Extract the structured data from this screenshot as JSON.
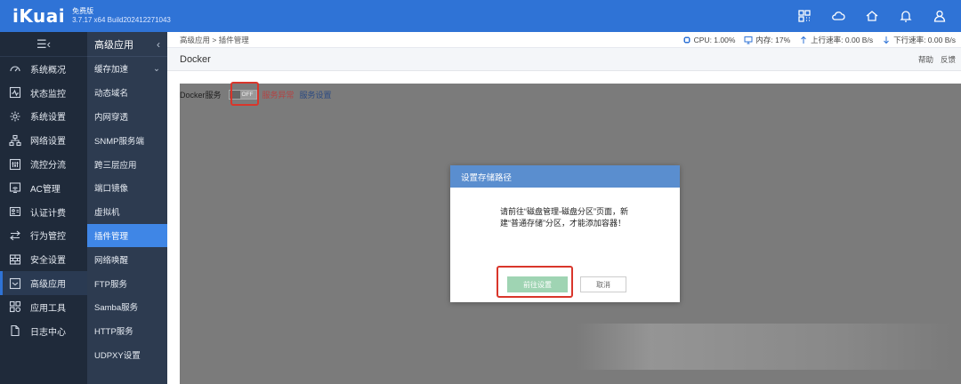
{
  "brand": {
    "logo": "iKuai",
    "edition": "免费版",
    "build": "3.7.17 x64 Build202412271043"
  },
  "topbar_icons": [
    "grid-apps-icon",
    "cloud-icon",
    "home-icon",
    "bell-icon",
    "user-icon"
  ],
  "nav": {
    "toggle": "☰‹",
    "items": [
      {
        "label": "系统概况",
        "icon": "speedometer-icon"
      },
      {
        "label": "状态监控",
        "icon": "pulse-icon"
      },
      {
        "label": "系统设置",
        "icon": "gear-icon"
      },
      {
        "label": "网络设置",
        "icon": "network-icon"
      },
      {
        "label": "流控分流",
        "icon": "sliders-icon"
      },
      {
        "label": "AC管理",
        "icon": "wifi-ap-icon"
      },
      {
        "label": "认证计费",
        "icon": "id-card-icon"
      },
      {
        "label": "行为管控",
        "icon": "swap-arrows-icon"
      },
      {
        "label": "安全设置",
        "icon": "firewall-icon"
      },
      {
        "label": "高级应用",
        "icon": "app-box-icon"
      },
      {
        "label": "应用工具",
        "icon": "tools-grid-icon"
      },
      {
        "label": "日志中心",
        "icon": "document-icon"
      }
    ],
    "active_index": 9
  },
  "subnav": {
    "title": "高级应用",
    "items": [
      "缓存加速",
      "动态域名",
      "内网穿透",
      "SNMP服务端",
      "跨三层应用",
      "端口镜像",
      "虚拟机",
      "插件管理",
      "网络唤醒",
      "FTP服务",
      "Samba服务",
      "HTTP服务",
      "UDPXY设置"
    ],
    "active_index": 7
  },
  "content": {
    "breadcrumb": "高级应用 > 插件管理",
    "stats": {
      "cpu": "CPU: 1.00%",
      "mem": "内存: 17%",
      "up": "上行速率: 0.00 B/s",
      "down": "下行速率: 0.00 B/s"
    },
    "page_title": "Docker",
    "help": "帮助",
    "feedback": "反馈",
    "docker": {
      "label": "Docker服务",
      "toggle_text": "OFF",
      "status": "服务异常",
      "settings": "服务设置"
    }
  },
  "dialog": {
    "title": "设置存储路径",
    "message": "请前往“磁盘管理-磁盘分区”页面，新建“普通存储”分区，才能添加容器！",
    "confirm": "前往设置",
    "cancel": "取消"
  },
  "colors": {
    "topbar": "#2f73d6",
    "sidebar": "#1f2a3a",
    "subnav": "#2d3b50",
    "subnav_active": "#3f86e6",
    "overlay": "#7b7b7b",
    "dialog_header": "#5a8ecf",
    "confirm_button": "#9fd4b3",
    "highlight_box": "#d9362b"
  }
}
